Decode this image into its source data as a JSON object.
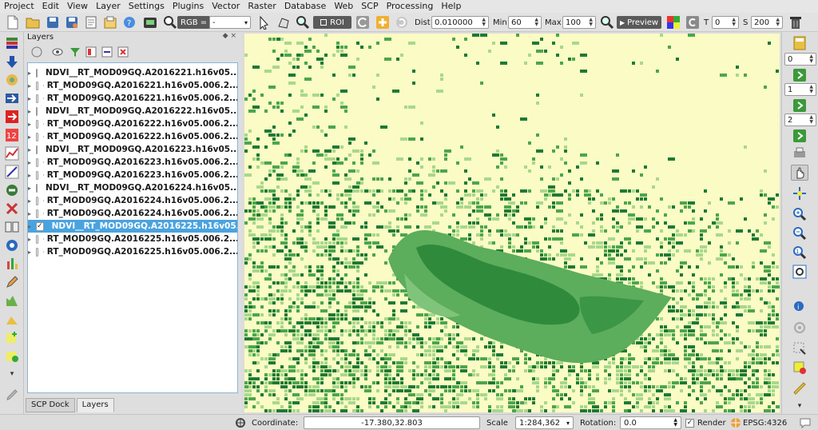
{
  "menu": [
    "Project",
    "Edit",
    "View",
    "Layer",
    "Settings",
    "Plugins",
    "Vector",
    "Raster",
    "Database",
    "Web",
    "SCP",
    "Processing",
    "Help"
  ],
  "toolbar": {
    "rgb_label": "RGB =",
    "rgb_value": "-",
    "roi_label": "ROI",
    "dist_label": "Dist",
    "dist_value": "0.010000",
    "min_label": "Min",
    "min_value": "60",
    "max_label": "Max",
    "max_value": "100",
    "preview_label": "Preview",
    "t_label": "T",
    "t_value": "0",
    "s_label": "S",
    "s_value": "200"
  },
  "layers_panel": {
    "title": "Layers",
    "controls": "◆ ×",
    "layers": [
      {
        "name": "NDVI__RT_MOD09GQ.A2016221.h16v05...",
        "checked": false,
        "selected": false
      },
      {
        "name": "RT_MOD09GQ.A2016221.h16v05.006.2...",
        "checked": false,
        "selected": false
      },
      {
        "name": "RT_MOD09GQ.A2016221.h16v05.006.2...",
        "checked": false,
        "selected": false
      },
      {
        "name": "NDVI__RT_MOD09GQ.A2016222.h16v05...",
        "checked": false,
        "selected": false
      },
      {
        "name": "RT_MOD09GQ.A2016222.h16v05.006.2...",
        "checked": false,
        "selected": false
      },
      {
        "name": "RT_MOD09GQ.A2016222.h16v05.006.2...",
        "checked": false,
        "selected": false
      },
      {
        "name": "NDVI__RT_MOD09GQ.A2016223.h16v05...",
        "checked": false,
        "selected": false
      },
      {
        "name": "RT_MOD09GQ.A2016223.h16v05.006.2...",
        "checked": false,
        "selected": false
      },
      {
        "name": "RT_MOD09GQ.A2016223.h16v05.006.2...",
        "checked": false,
        "selected": false
      },
      {
        "name": "NDVI__RT_MOD09GQ.A2016224.h16v05...",
        "checked": false,
        "selected": false
      },
      {
        "name": "RT_MOD09GQ.A2016224.h16v05.006.2...",
        "checked": false,
        "selected": false
      },
      {
        "name": "RT_MOD09GQ.A2016224.h16v05.006.2...",
        "checked": false,
        "selected": false
      },
      {
        "name": "NDVI__RT_MOD09GQ.A2016225.h16v05...",
        "checked": true,
        "selected": true
      },
      {
        "name": "RT_MOD09GQ.A2016225.h16v05.006.2...",
        "checked": false,
        "selected": false
      },
      {
        "name": "RT_MOD09GQ.A2016225.h16v05.006.2...",
        "checked": false,
        "selected": false
      }
    ]
  },
  "dock_tabs": [
    "SCP Dock",
    "Layers"
  ],
  "right_panel": {
    "spin1": "0",
    "spin2": "1",
    "spin3": "2"
  },
  "statusbar": {
    "coordinate_label": "Coordinate:",
    "coordinate_value": "-17.380,32.803",
    "scale_label": "Scale",
    "scale_value": "1:284,362",
    "rotation_label": "Rotation:",
    "rotation_value": "0.0",
    "render_label": "Render",
    "crs_label": "EPSG:4326"
  },
  "colors": {
    "map_background": "#fbfbc5",
    "selection": "#4aa3df",
    "ndvi_dark": "#1e7a34",
    "ndvi_mid": "#4ca64c",
    "ndvi_light": "#a8d88c"
  }
}
